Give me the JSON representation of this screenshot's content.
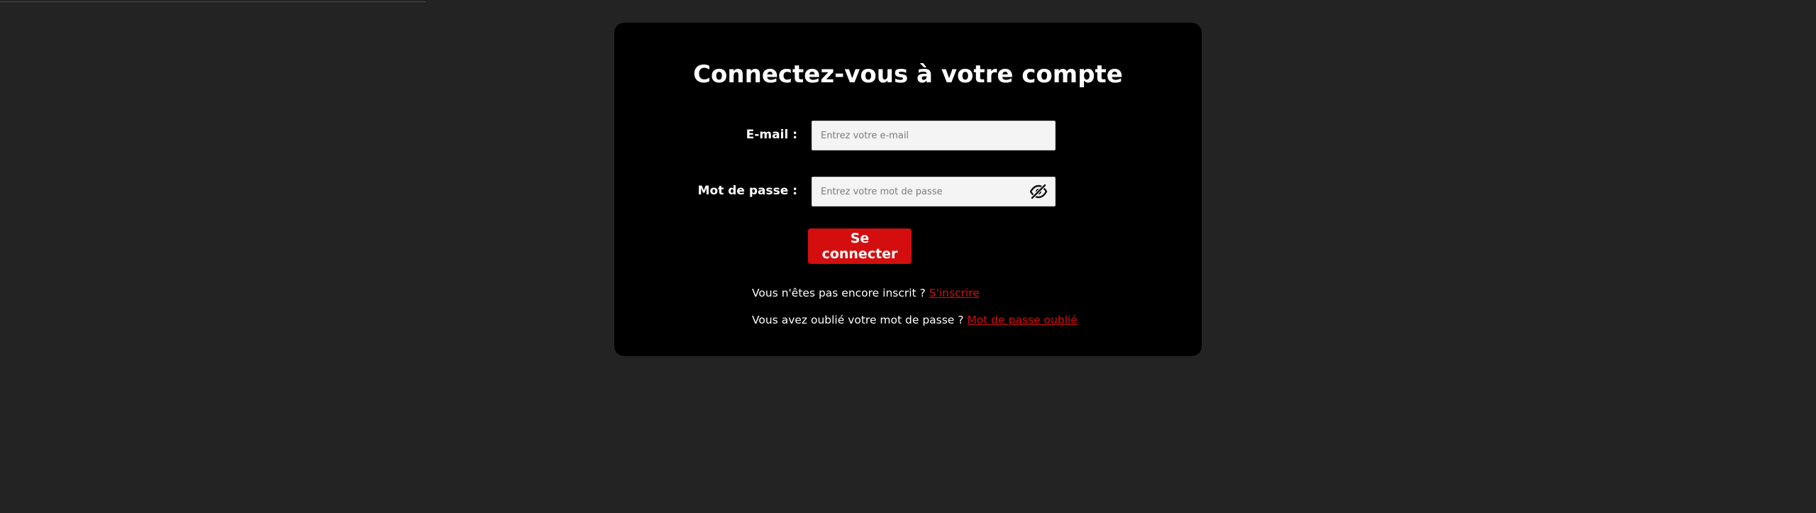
{
  "login": {
    "title": "Connectez-vous à votre compte",
    "email": {
      "label": "E-mail :",
      "placeholder": "Entrez votre e-mail",
      "value": ""
    },
    "password": {
      "label": "Mot de passe :",
      "placeholder": "Entrez votre mot de passe",
      "value": "",
      "toggle_icon": "eye-off-icon"
    },
    "submit_label": "Se connecter",
    "signup_prompt": "Vous n'êtes pas encore inscrit ?",
    "signup_link": "S'inscrire",
    "forgot_prompt": "Vous avez oublié votre mot de passe ?",
    "forgot_link": "Mot de passe oublié"
  },
  "colors": {
    "page_background": "#232323",
    "card_background": "#000000",
    "accent": "#d40e0e",
    "input_background": "#f4f4f4"
  }
}
